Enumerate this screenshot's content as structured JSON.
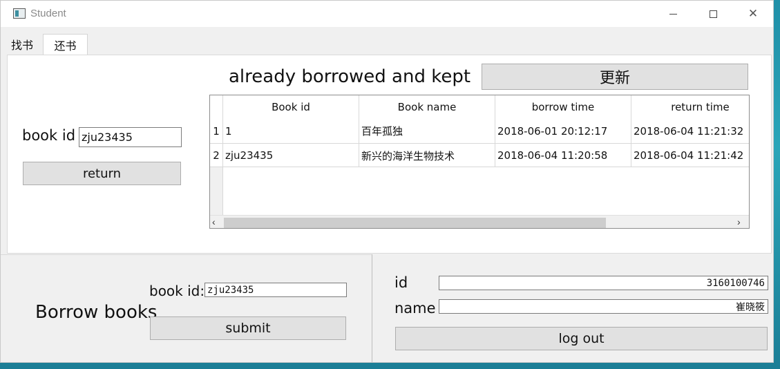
{
  "window": {
    "title": "Student",
    "minimize_icon": "minimize-icon",
    "maximize_icon": "maximize-icon",
    "close_icon": "close-icon",
    "close_glyph": "✕"
  },
  "tabs": [
    {
      "label": "找书",
      "active": false
    },
    {
      "label": "还书",
      "active": true
    }
  ],
  "return_panel": {
    "book_id_label": "book id",
    "book_id_value": "zju23435",
    "return_button": "return"
  },
  "borrowed": {
    "title": "already borrowed and kept",
    "refresh_button": "更新",
    "table": {
      "columns": [
        "Book id",
        "Book name",
        "borrow time",
        "return time"
      ],
      "rows": [
        {
          "row_number": "1",
          "cells": [
            "1",
            "百年孤独",
            "2018-06-01 20:12:17",
            "2018-06-04 11:21:32"
          ]
        },
        {
          "row_number": "2",
          "cells": [
            "zju23435",
            "新兴的海洋生物技术",
            "2018-06-04 11:20:58",
            "2018-06-04 11:21:42"
          ]
        }
      ],
      "scroll_left_glyph": "‹",
      "scroll_right_glyph": "›"
    }
  },
  "borrow_panel": {
    "title": "Borrow books",
    "book_id_label": "book id:",
    "book_id_value": "zju23435",
    "submit_button": "submit"
  },
  "user_panel": {
    "id_label": "id",
    "id_value": "3160100746",
    "name_label": "name",
    "name_value": "崔晓筱",
    "logout_button": "log out"
  },
  "colors": {
    "window_bg": "#f0f0f0",
    "button_bg": "#e1e1e1",
    "desktop": "#1f8fa8"
  }
}
